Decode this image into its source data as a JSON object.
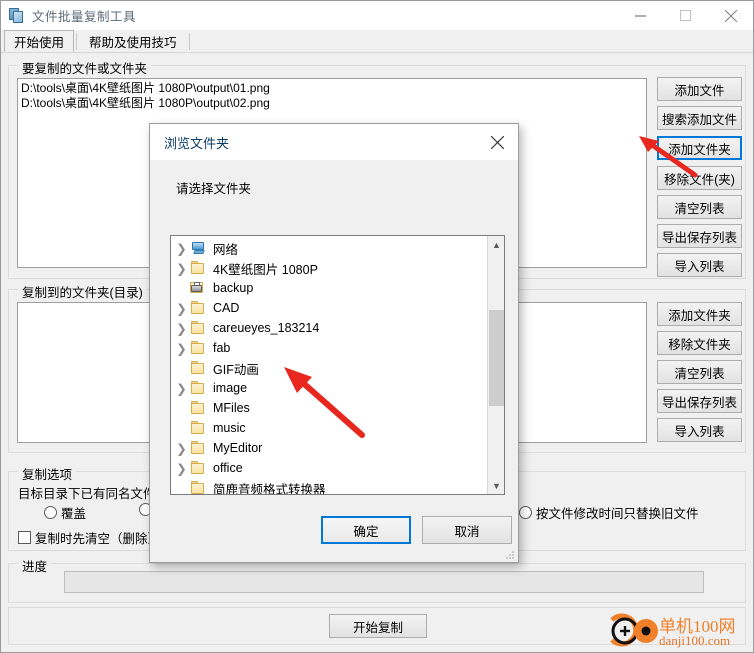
{
  "window": {
    "title": "文件批量复制工具",
    "icon": "copy-files-icon",
    "minimize": "–",
    "maximize": "□",
    "close": "✕"
  },
  "tabs": [
    {
      "label": "开始使用",
      "active": true
    },
    {
      "label": "帮助及使用技巧",
      "active": false
    }
  ],
  "source_group": {
    "legend": "要复制的文件或文件夹",
    "items": [
      "D:\\tools\\桌面\\4K壁纸图片 1080P\\output\\01.png",
      "D:\\tools\\桌面\\4K壁纸图片 1080P\\output\\02.png"
    ],
    "buttons": [
      {
        "label": "添加文件",
        "focused": false
      },
      {
        "label": "搜索添加文件",
        "focused": false
      },
      {
        "label": "添加文件夹",
        "focused": true
      },
      {
        "label": "移除文件(夹)",
        "focused": false
      },
      {
        "label": "清空列表",
        "focused": false
      },
      {
        "label": "导出保存列表",
        "focused": false
      },
      {
        "label": "导入列表",
        "focused": false
      }
    ]
  },
  "dest_group": {
    "legend": "复制到的文件夹(目录)",
    "items": [],
    "buttons": [
      {
        "label": "添加文件夹",
        "focused": false
      },
      {
        "label": "移除文件夹",
        "focused": false
      },
      {
        "label": "清空列表",
        "focused": false
      },
      {
        "label": "导出保存列表",
        "focused": false
      },
      {
        "label": "导入列表",
        "focused": false
      }
    ]
  },
  "options_group": {
    "legend": "复制选项",
    "same_name_label": "目标目录下已有同名文件",
    "radio_overwrite": "覆盖",
    "radio_skip": "",
    "radio_replace_old": "按文件修改时间只替换旧文件",
    "checkbox_clear_first": "复制时先清空（删除）"
  },
  "progress_group": {
    "legend": "进度",
    "value": ""
  },
  "start_button": {
    "label": "开始复制"
  },
  "dialog": {
    "title": "浏览文件夹",
    "close": "✕",
    "prompt": "请选择文件夹",
    "tree": [
      {
        "label": "网络",
        "icon": "network-icon",
        "expandable": true
      },
      {
        "label": "4K壁纸图片 1080P",
        "icon": "folder-icon",
        "expandable": true
      },
      {
        "label": "backup",
        "icon": "shared-folder-icon",
        "expandable": false
      },
      {
        "label": "CAD",
        "icon": "folder-icon",
        "expandable": true
      },
      {
        "label": "careueyes_183214",
        "icon": "folder-icon",
        "expandable": true
      },
      {
        "label": "fab",
        "icon": "folder-icon",
        "expandable": true
      },
      {
        "label": "GIF动画",
        "icon": "folder-icon",
        "expandable": false
      },
      {
        "label": "image",
        "icon": "folder-icon",
        "expandable": true
      },
      {
        "label": "MFiles",
        "icon": "folder-icon",
        "expandable": false
      },
      {
        "label": "music",
        "icon": "folder-icon",
        "expandable": false
      },
      {
        "label": "MyEditor",
        "icon": "folder-icon",
        "expandable": true
      },
      {
        "label": "office",
        "icon": "folder-icon",
        "expandable": true
      },
      {
        "label": "简鹿音频格式转换器",
        "icon": "folder-icon",
        "expandable": false
      }
    ],
    "ok": "确定",
    "cancel": "取消"
  },
  "watermark": {
    "line1": "单机100网",
    "line2": "danji100.com"
  },
  "colors": {
    "accent": "#0078d7",
    "window_bg": "#f0f0f0",
    "arrow_red": "#e8281e",
    "watermark_orange": "#f0812a"
  }
}
